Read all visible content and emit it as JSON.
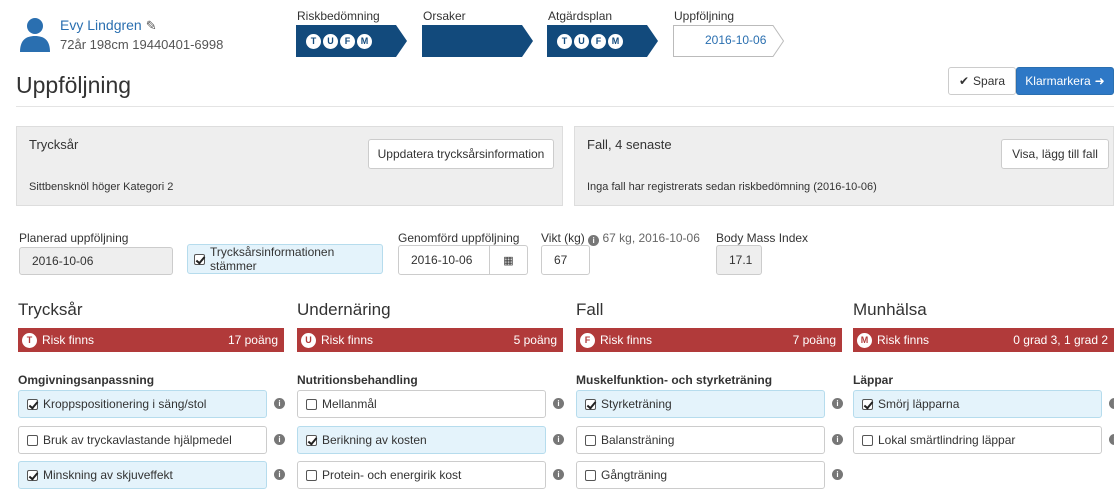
{
  "patient": {
    "name": "Evy Lindgren",
    "meta": "72år 198cm 19440401-6998"
  },
  "steps": [
    {
      "label": "Riskbedömning",
      "badges": [
        "T",
        "U",
        "F",
        "M"
      ]
    },
    {
      "label": "Orsaker"
    },
    {
      "label": "Atgärdsplan",
      "badges": [
        "T",
        "U",
        "F",
        "M"
      ]
    },
    {
      "label": "Uppföljning",
      "date": "2016-10-06"
    }
  ],
  "page": {
    "title": "Uppföljning"
  },
  "toolbar": {
    "save_label": "Spara",
    "done_label": "Klarmarkera"
  },
  "tryck_panel": {
    "title": "Trycksår",
    "button": "Uppdatera trycksårsinformation",
    "detail": "Sittbensknöl höger  Kategori 2"
  },
  "fall_panel": {
    "title": "Fall, 4 senaste",
    "button": "Visa, lägg till fall",
    "detail": "Inga fall har registrerats sedan riskbedömning (2016-10-06)"
  },
  "form": {
    "planned_label": "Planerad uppföljning",
    "planned_value": "2016-10-06",
    "confirm_label": "Trycksårsinformationen stämmer",
    "done_label": "Genomförd uppföljning",
    "done_value": "2016-10-06",
    "weight_label": "Vikt (kg)",
    "weight_hint": "67 kg, 2016-10-06",
    "weight_value": "67",
    "bmi_label": "Body Mass Index",
    "bmi_value": "17.1"
  },
  "columns": [
    {
      "title": "Trycksår",
      "badge": "T",
      "risk": "Risk finns",
      "points": "17 poäng",
      "subheading": "Omgivningsanpassning",
      "items": [
        {
          "label": "Kroppspositionering i säng/stol",
          "checked": true
        },
        {
          "label": "Bruk av tryckavlastande hjälpmedel",
          "checked": false
        },
        {
          "label": "Minskning av skjuveffekt",
          "checked": true
        }
      ]
    },
    {
      "title": "Undernäring",
      "badge": "U",
      "risk": "Risk finns",
      "points": "5 poäng",
      "subheading": "Nutritionsbehandling",
      "items": [
        {
          "label": "Mellanmål",
          "checked": false
        },
        {
          "label": "Berikning av kosten",
          "checked": true
        },
        {
          "label": "Protein- och energirik kost",
          "checked": false
        }
      ]
    },
    {
      "title": "Fall",
      "badge": "F",
      "risk": "Risk finns",
      "points": "7 poäng",
      "subheading": "Muskelfunktion- och styrketräning",
      "items": [
        {
          "label": "Styrketräning",
          "checked": true
        },
        {
          "label": "Balansträning",
          "checked": false
        },
        {
          "label": "Gångträning",
          "checked": false
        }
      ]
    },
    {
      "title": "Munhälsa",
      "badge": "M",
      "risk": "Risk finns",
      "points": "0 grad 3, 1 grad 2",
      "subheading": "Läppar",
      "items": [
        {
          "label": "Smörj läpparna",
          "checked": true
        },
        {
          "label": "Lokal smärtlindring läppar",
          "checked": false
        }
      ]
    }
  ],
  "colors": {
    "brand": "#124a7c",
    "primary": "#2e78c6",
    "risk": "#b13a3a",
    "checked_bg": "#e4f3fb"
  }
}
